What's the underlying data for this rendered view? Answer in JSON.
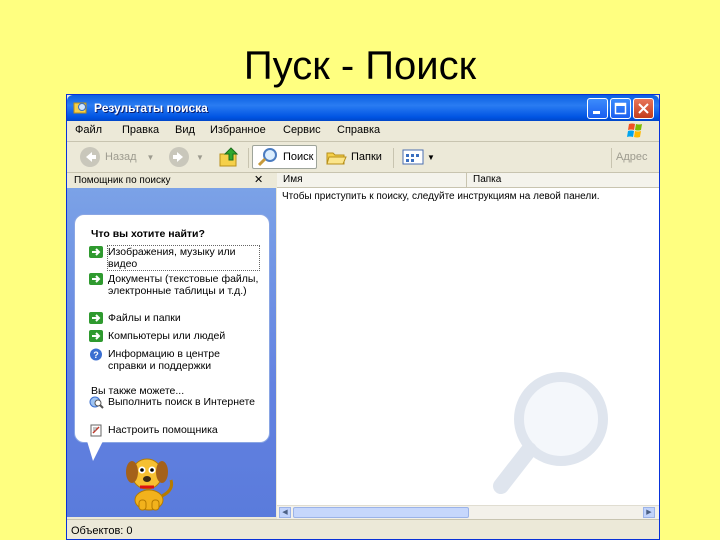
{
  "slide": {
    "title": "Пуск - Поиск"
  },
  "window": {
    "title": "Результаты поиска"
  },
  "menu": [
    "Файл",
    "Правка",
    "Вид",
    "Избранное",
    "Сервис",
    "Справка"
  ],
  "toolbar": {
    "back_label": "Назад",
    "search_label": "Поиск",
    "folders_label": "Папки",
    "address_label": "Адрес"
  },
  "search_pane": {
    "title": "Помощник по поиску",
    "question": "Что вы хотите найти?",
    "options": [
      {
        "label": "Изображения, музыку или видео",
        "icon": "green-arrow-icon"
      },
      {
        "label": "Документы (текстовые файлы, электронные таблицы и т.д.)",
        "icon": "green-arrow-icon"
      },
      {
        "label": "Файлы и папки",
        "icon": "green-arrow-icon"
      },
      {
        "label": "Компьютеры или людей",
        "icon": "green-arrow-icon"
      },
      {
        "label": "Информацию в центре справки и поддержки",
        "icon": "help-icon"
      }
    ],
    "also_label": "Вы также можете...",
    "also_options": [
      {
        "label": "Выполнить поиск в Интернете",
        "icon": "internet-search-icon"
      },
      {
        "label": "Настроить помощника",
        "icon": "settings-icon"
      }
    ]
  },
  "results": {
    "columns": [
      "Имя",
      "Папка"
    ],
    "instruction": "Чтобы приступить к поиску, следуйте инструкциям на левой панели."
  },
  "status": {
    "objects": "Объектов: 0"
  },
  "colors": {
    "slide_bg": "#ffff80",
    "title_bar": "#0054e3",
    "pane_bg": "#6f8fe2"
  }
}
